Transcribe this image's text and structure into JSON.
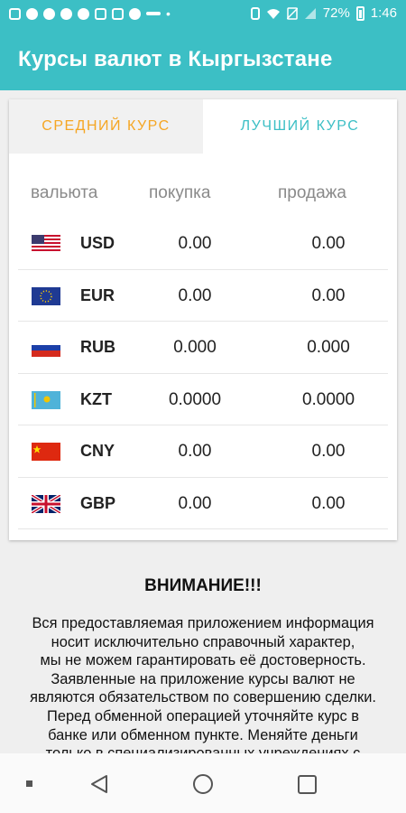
{
  "status_bar": {
    "battery": "72%",
    "time": "1:46",
    "notification_icons": [
      "shop-icon",
      "heart-message-icon",
      "heart-message-icon",
      "favorite-icon",
      "heart-message-icon",
      "person-icon",
      "instagram-icon",
      "keyhole-icon",
      "usb-icon",
      "dots-icon"
    ],
    "system_icons": [
      "vibrate-icon",
      "wifi-icon",
      "no-sim-icon",
      "signal-icon",
      "battery-icon"
    ]
  },
  "app_bar": {
    "title": "Курсы валют в Кыргызстане"
  },
  "tabs": [
    {
      "label": "СРЕДНИЙ КУРС",
      "selected": false,
      "color": "#f5a623"
    },
    {
      "label": "ЛУЧШИЙ КУРС",
      "selected": true,
      "color": "#3cbfc5"
    }
  ],
  "table": {
    "headers": {
      "currency": "вальюта",
      "buy": "покупка",
      "sell": "продажа"
    },
    "rows": [
      {
        "code": "USD",
        "flag": "flag-us-icon",
        "buy": "0.00",
        "sell": "0.00"
      },
      {
        "code": "EUR",
        "flag": "flag-eu-icon",
        "buy": "0.00",
        "sell": "0.00"
      },
      {
        "code": "RUB",
        "flag": "flag-ru-icon",
        "buy": "0.000",
        "sell": "0.000"
      },
      {
        "code": "KZT",
        "flag": "flag-kz-icon",
        "buy": "0.0000",
        "sell": "0.0000"
      },
      {
        "code": "CNY",
        "flag": "flag-cn-icon",
        "buy": "0.00",
        "sell": "0.00"
      },
      {
        "code": "GBP",
        "flag": "flag-gb-icon",
        "buy": "0.00",
        "sell": "0.00"
      }
    ]
  },
  "notice": {
    "title": "ВНИМАНИЕ!!!",
    "lines": [
      "Вся предоставляемая приложением информация",
      "носит исключительно справочный характер,",
      "мы не можем гарантировать её достоверность.",
      "Заявленные на приложение курсы валют не",
      "являются обязательством по совершению сделки.",
      "Перед обменной операцией уточняйте курс в",
      "банке или обменном пункте. Меняйте деньги",
      "только в специализированных учреждениях с"
    ]
  },
  "colors": {
    "accent": "#3cbfc5",
    "secondary": "#f5a623"
  }
}
